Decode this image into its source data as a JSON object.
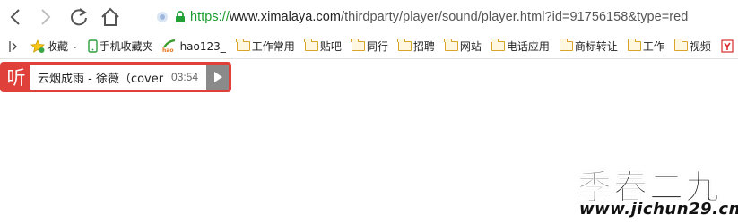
{
  "browser": {
    "address_bar": {
      "url_scheme": "https://",
      "url_host": "www.ximalaya.com",
      "url_path": "/thirdparty/player/sound/player.html?id=91756158&type=red"
    }
  },
  "bookmarks_bar": {
    "items": [
      {
        "label": "收藏",
        "icon": "star-icon"
      },
      {
        "label": "手机收藏夹",
        "icon": "mobile-icon"
      },
      {
        "label": "hao123_",
        "icon": "hao123-icon"
      },
      {
        "label": "工作常用",
        "icon": "folder-icon"
      },
      {
        "label": "贴吧",
        "icon": "folder-icon"
      },
      {
        "label": "同行",
        "icon": "folder-icon"
      },
      {
        "label": "招聘",
        "icon": "folder-icon"
      },
      {
        "label": "网站",
        "icon": "folder-icon"
      },
      {
        "label": "电话应用",
        "icon": "folder-icon"
      },
      {
        "label": "商标转让",
        "icon": "folder-icon"
      },
      {
        "label": "工作",
        "icon": "folder-icon"
      },
      {
        "label": "视频",
        "icon": "folder-icon"
      }
    ]
  },
  "player": {
    "logo_text": "听",
    "track_title": "云烟成雨 - 徐薇（cover",
    "duration": "03:54",
    "accent_color": "#e0403a"
  },
  "watermark": {
    "title": "季春二九",
    "url": "www.jichun29.cn"
  }
}
